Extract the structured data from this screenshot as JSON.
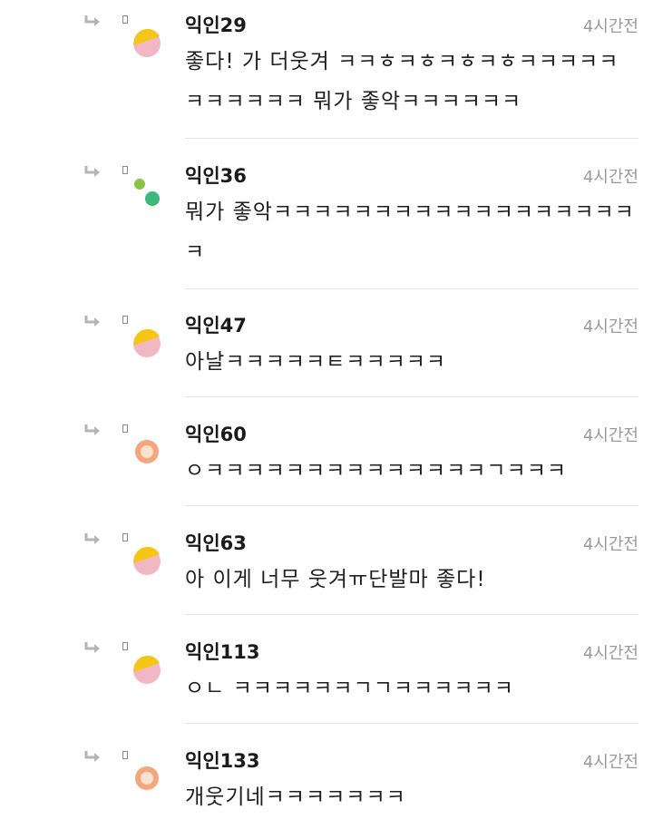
{
  "comments": [
    {
      "author": "익인29",
      "time": "4시간전",
      "line1": "좋다! 가 더웃겨 ㅋㅋㅎㅋㅎㅋㅎㅋㅎㅋㅋㅋㅋㅋ",
      "line2": "ㅋㅋㅋㅋㅋㅋ 뭐가 좋악ㅋㅋㅋㅋㅋㅋ",
      "avatar": "yellow-pink"
    },
    {
      "author": "익인36",
      "time": "4시간전",
      "line1": "뭐가 좋악ㅋㅋㅋㅋㅋㅋㅋㅋㅋㅋㅋㅋㅋㅋㅋㅋㅋㅋ",
      "line2": "ㅋ",
      "avatar": "green-dots"
    },
    {
      "author": "익인47",
      "time": "4시간전",
      "line1": "아날ㅋㅋㅋㅋㅋㅌㅋㅋㅋㅋㅋ",
      "line2": "",
      "avatar": "yellow-pink"
    },
    {
      "author": "익인60",
      "time": "4시간전",
      "line1": "ㅇㅋㅋㅋㅋㅋㅋㅋㅋㅋㅋㅋㅋㅋㅋㄱㅋㅋㅋ",
      "line2": "",
      "avatar": "orange-ring"
    },
    {
      "author": "익인63",
      "time": "4시간전",
      "line1": "아 이게 너무 웃겨ㅠ단발마 좋다!",
      "line2": "",
      "avatar": "yellow-pink"
    },
    {
      "author": "익인113",
      "time": "4시간전",
      "line1": "ㅇㄴ ㅋㅋㅋㅋㅋㅋㄱㄱㅋㅋㅋㅋㅋㅋ",
      "line2": "",
      "avatar": "yellow-pink"
    },
    {
      "author": "익인133",
      "time": "4시간전",
      "line1": "개웃기네ㅋㅋㅋㅋㅋㅋㅋ",
      "line2": "",
      "avatar": "orange-ring"
    }
  ],
  "colors": {
    "avatar_yellow": "#f5c518",
    "avatar_pink": "#f2b7c5",
    "avatar_green": "#3cb878",
    "avatar_lightgreen": "#8bc34a",
    "avatar_orange": "#f4a77f",
    "divider": "#e6e6e6",
    "time_text": "#9a9a9a"
  },
  "icons": {
    "reply": "reply-arrow-icon",
    "marker": "small-box-icon"
  }
}
